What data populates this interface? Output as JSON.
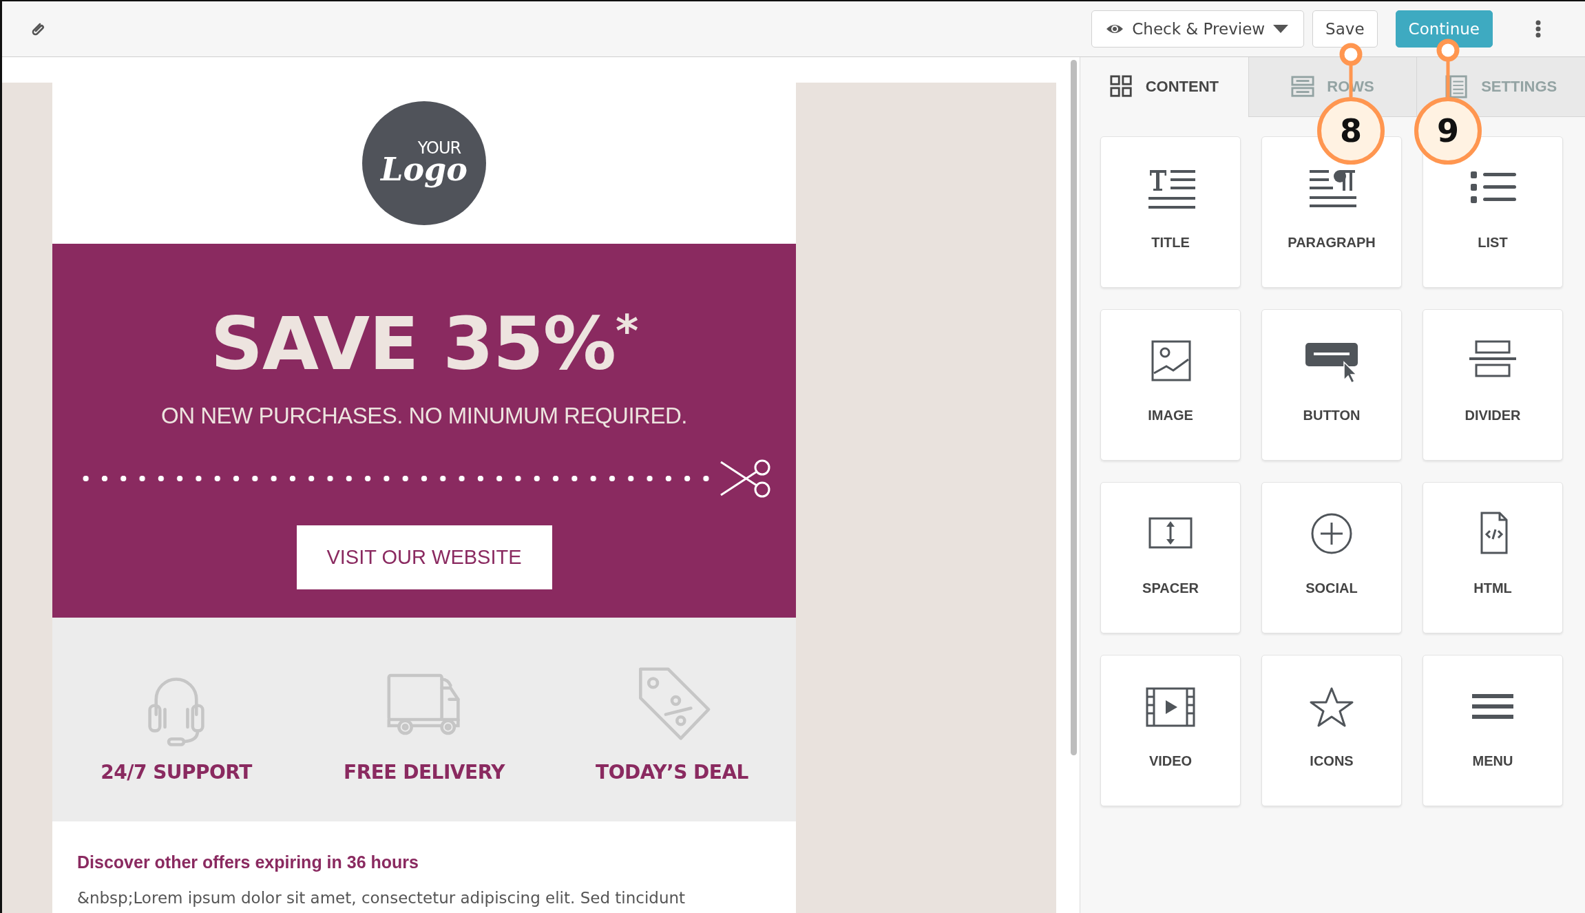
{
  "toolbar": {
    "buttons": [
      {
        "kind": "preview",
        "label": "Check & Preview"
      },
      {
        "kind": "save",
        "label": "Save"
      },
      {
        "kind": "primary",
        "label": "Continue"
      }
    ]
  },
  "email": {
    "logo": {
      "line_1": "YOUR",
      "line_2": "Logo"
    },
    "hero": {
      "headline": "SAVE 35%$^{*}$",
      "subheadline": "ON NEW PURCHASES. NO MINUMUM REQUIRED.",
      "button": "VISIT OUR WEBSITE"
    },
    "features": [
      {
        "kind": "support",
        "label": "24/7 SUPPORT"
      },
      {
        "kind": "delivery",
        "label": "FREE DELIVERY"
      },
      {
        "kind": "deal",
        "label": "TODAY’S DEAL"
      }
    ],
    "text_block": {
      "heading": "Discover other offers expiring in 36 hours",
      "body": "&nbsp;Lorem ipsum dolor sit amet, consectetur adipiscing elit. Sed tincidunt"
    }
  },
  "panel": {
    "tabs": [
      {
        "kind": "content",
        "label": "CONTENT",
        "selected": true
      },
      {
        "kind": "rows",
        "label": "ROWS",
        "selected": false
      },
      {
        "kind": "settings",
        "label": "SETTINGS",
        "selected": false
      }
    ],
    "blocks": [
      {
        "kind": "title",
        "label": "TITLE"
      },
      {
        "kind": "paragraph",
        "label": "PARAGRAPH"
      },
      {
        "kind": "list",
        "label": "LIST"
      },
      {
        "kind": "image",
        "label": "IMAGE"
      },
      {
        "kind": "button",
        "label": "BUTTON"
      },
      {
        "kind": "divider",
        "label": "DIVIDER"
      },
      {
        "kind": "spacer",
        "label": "SPACER"
      },
      {
        "kind": "social",
        "label": "SOCIAL"
      },
      {
        "kind": "html",
        "label": "HTML"
      },
      {
        "kind": "video",
        "label": "VIDEO"
      },
      {
        "kind": "icons",
        "label": "ICONS"
      },
      {
        "kind": "menu",
        "label": "MENU"
      }
    ]
  },
  "callouts": [
    {
      "label": "8"
    },
    {
      "label": "9"
    }
  ]
}
